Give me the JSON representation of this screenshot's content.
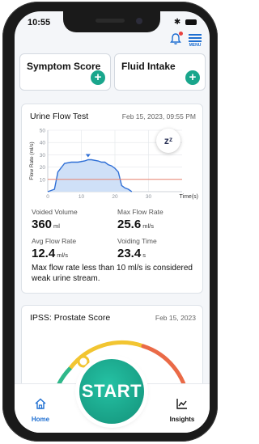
{
  "status": {
    "time": "10:55"
  },
  "header": {
    "menu_label": "MENU"
  },
  "quick_cards": [
    {
      "label": "Symptom Score"
    },
    {
      "label": "Fluid Intake"
    }
  ],
  "urine_test": {
    "title": "Urine Flow Test",
    "date": "Feb 15, 2023, 09:55 PM",
    "sleep_badge": "zᶻ",
    "stats": {
      "voided_volume_label": "Voided Volume",
      "voided_volume_value": "360",
      "voided_volume_unit": "ml",
      "max_flow_label": "Max Flow Rate",
      "max_flow_value": "25.6",
      "max_flow_unit": "ml/s",
      "avg_flow_label": "Avg Flow Rate",
      "avg_flow_value": "12.4",
      "avg_flow_unit": "ml/s",
      "voiding_time_label": "Voiding Time",
      "voiding_time_value": "23.4",
      "voiding_time_unit": "s"
    },
    "note": "Max flow rate less than 10 ml/s is considered weak urine stream."
  },
  "chart_data": {
    "type": "area",
    "ylabel": "Flow Rate (ml/s)",
    "xlabel": "Time(s)",
    "x_ticks": [
      0,
      10,
      20,
      30
    ],
    "y_ticks": [
      10,
      20,
      30,
      40,
      50
    ],
    "ylim": [
      0,
      50
    ],
    "xlim": [
      0,
      40
    ],
    "threshold": 10,
    "x": [
      0,
      2,
      3,
      5,
      7,
      9,
      11,
      12,
      13,
      15,
      16,
      17,
      18,
      19,
      20,
      21,
      22,
      23,
      24,
      25
    ],
    "y": [
      0,
      2,
      16,
      23,
      24,
      24,
      25,
      26,
      26,
      25,
      24,
      24,
      22,
      21,
      19,
      16,
      5,
      3,
      2,
      0
    ],
    "grid": true,
    "colors": {
      "fill": "#cfe0f7",
      "line": "#2f6fd6",
      "threshold": "#e8826f",
      "marker": "#2f6fd6"
    }
  },
  "ipss": {
    "title": "IPSS: Prostate Score",
    "date": "Feb 15, 2023"
  },
  "nav": {
    "home_label": "Home",
    "start_label": "START",
    "insights_label": "Insights"
  }
}
